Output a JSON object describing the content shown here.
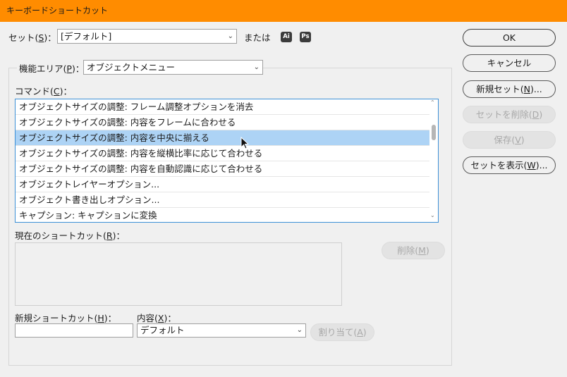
{
  "window": {
    "title": "キーボードショートカット"
  },
  "set_row": {
    "label": "セット(",
    "mnemonic": "S",
    "label_end": ")：",
    "value": "[デフォルト]",
    "or_text": "または",
    "badges": [
      "Ai",
      "Ps"
    ]
  },
  "area_row": {
    "label": "機能エリア(",
    "mnemonic": "P",
    "label_end": ")：",
    "value": "オブジェクトメニュー"
  },
  "commands": {
    "label": "コマンド(",
    "mnemonic": "C",
    "label_end": ")：",
    "items": [
      "オブジェクトサイズの調整: フレーム調整オプションを消去",
      "オブジェクトサイズの調整: 内容をフレームに合わせる",
      "オブジェクトサイズの調整: 内容を中央に揃える",
      "オブジェクトサイズの調整: 内容を縦横比率に応じて合わせる",
      "オブジェクトサイズの調整: 内容を自動認識に応じて合わせる",
      "オブジェクトレイヤーオプション...",
      "オブジェクト書き出しオプション...",
      "キャプション: キャプションに変換"
    ],
    "selected_index": 2
  },
  "current_shortcut": {
    "label": "現在のショートカット(",
    "mnemonic": "R",
    "label_end": ")：",
    "delete_button": {
      "label": "削除(",
      "mnemonic": "M",
      "label_end": ")"
    }
  },
  "new_shortcut": {
    "label": "新規ショートカット(",
    "mnemonic": "H",
    "label_end": ")：",
    "value": ""
  },
  "context": {
    "label": "内容(",
    "mnemonic": "X",
    "label_end": ")：",
    "value": "デフォルト"
  },
  "assign_button": {
    "label": "割り当て(",
    "mnemonic": "A",
    "label_end": ")"
  },
  "side_buttons": {
    "ok": {
      "label": "OK"
    },
    "cancel": {
      "label": "キャンセル"
    },
    "new_set": {
      "label": "新規セット(",
      "mnemonic": "N",
      "label_end": ")..."
    },
    "delete_set": {
      "label": "セットを削除(",
      "mnemonic": "D",
      "label_end": ")"
    },
    "save": {
      "label": "保存(",
      "mnemonic": "V",
      "label_end": ")"
    },
    "show_set": {
      "label": "セットを表示(",
      "mnemonic": "W",
      "label_end": ")..."
    }
  },
  "colors": {
    "title_bar": "#ff8c00",
    "selection": "#add3f5",
    "list_border": "#3c8fd6"
  }
}
